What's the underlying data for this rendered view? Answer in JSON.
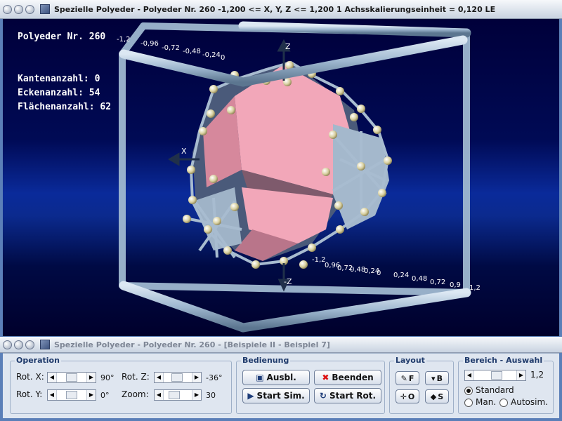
{
  "window": {
    "title": "Spezielle Polyeder - Polyeder Nr. 260   -1,200 <= X, Y, Z <= 1,200    1 Achsskalierungseinheit = 0,120 LE",
    "panel_title": "Spezielle Polyeder - Polyeder Nr. 260 - [Beispiele II - Beispiel 7]"
  },
  "info": {
    "name": "Polyeder Nr. 260",
    "edges": "Kantenanzahl: 0",
    "vertices": "Eckenanzahl: 54",
    "faces": "Flächenanzahl: 62"
  },
  "axes": {
    "x_label": "X",
    "z_label": "Z",
    "neg_z_label": "-Z",
    "top_ticks": [
      "-1,2",
      "-0,96",
      "-0,72",
      "-0,48",
      "-0,24",
      "0"
    ],
    "bottom_ticks": [
      "0,24",
      "0,48",
      "0,72",
      "0,9",
      "1,2"
    ],
    "bottom_mid_ticks": [
      "-1,2",
      "0,96",
      "0,72",
      "0,48",
      "0,24",
      "0"
    ]
  },
  "operation": {
    "group": "Operation",
    "rot_x_label": "Rot. X:",
    "rot_x_value": "90°",
    "rot_x_level": 0.5,
    "rot_y_label": "Rot. Y:",
    "rot_y_value": "0°",
    "rot_y_level": 0.5,
    "rot_z_label": "Rot. Z:",
    "rot_z_value": "-36°",
    "rot_z_level": 0.45,
    "zoom_label": "Zoom:",
    "zoom_value": "30",
    "zoom_level": 0.3
  },
  "bedienung": {
    "group": "Bedienung",
    "ausbl": "Ausbl.",
    "beenden": "Beenden",
    "start_sim": "Start Sim.",
    "start_rot": "Start Rot."
  },
  "layout": {
    "group": "Layout",
    "f": "F",
    "b": "B",
    "o": "O",
    "s": "S"
  },
  "bereich": {
    "group": "Bereich - Auswahl",
    "value": "1,2",
    "level": 0.55,
    "standard": "Standard",
    "man": "Man.",
    "autosim": "Autosim."
  },
  "colors": {
    "frame": "#9fb8d0",
    "face": "#f5a0b5",
    "vertex": "#d8d0a0"
  }
}
